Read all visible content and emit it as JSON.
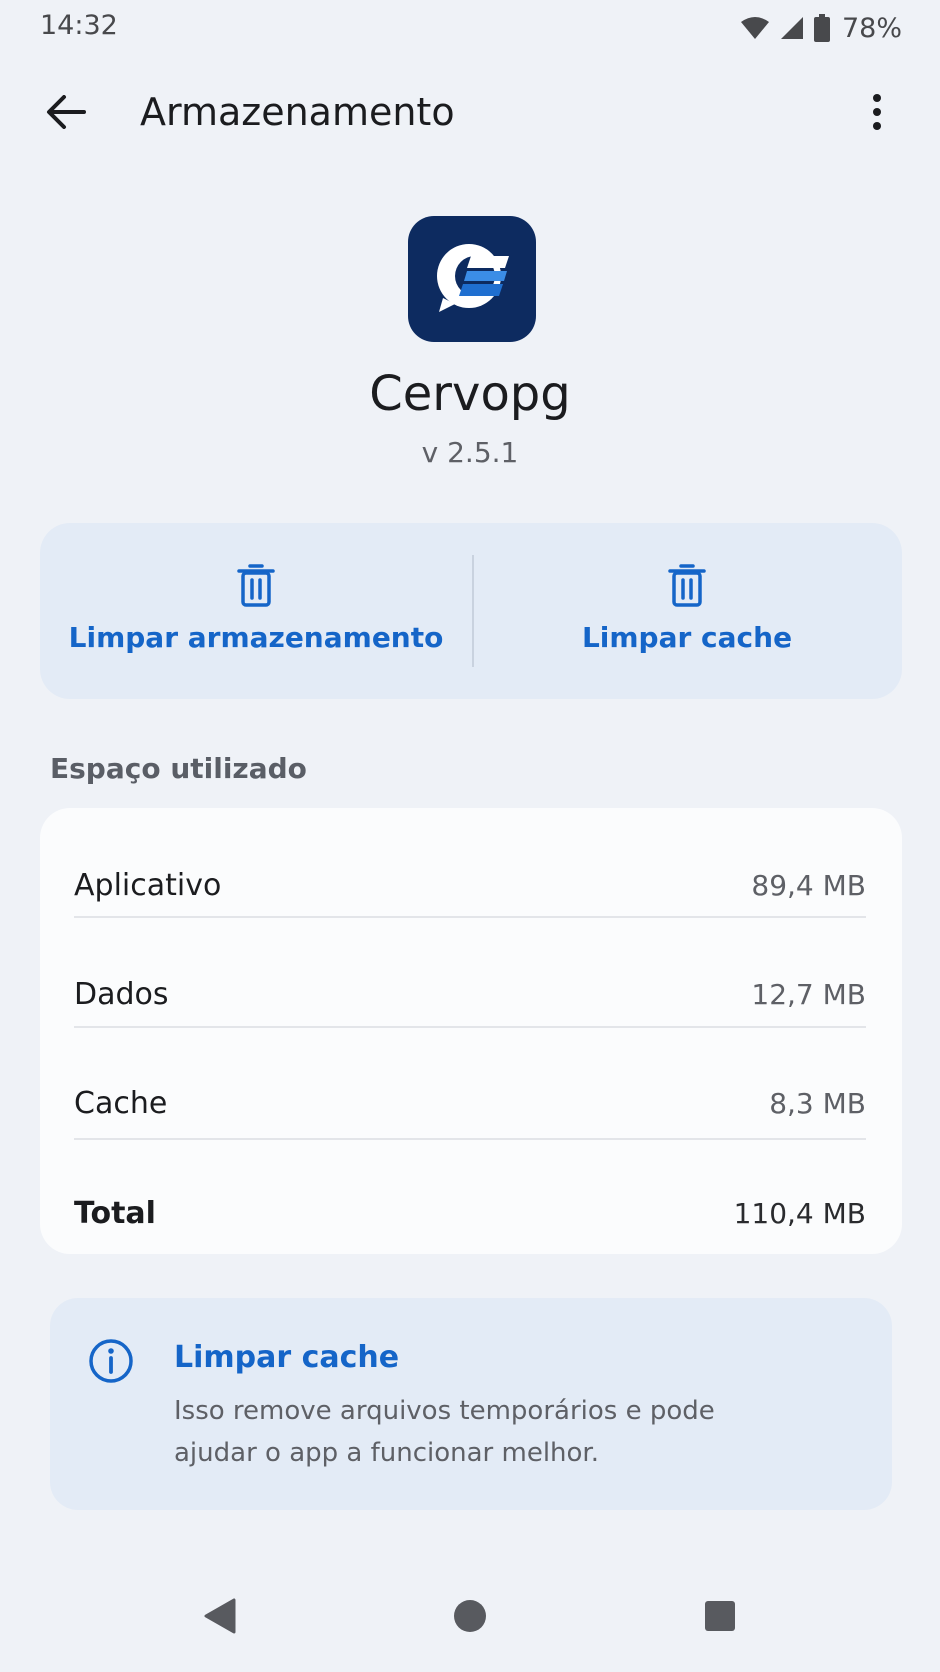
{
  "status_bar": {
    "time": "14:32",
    "battery": "78%",
    "icons": [
      "wifi-icon",
      "signal-icon",
      "battery-icon"
    ]
  },
  "app_bar": {
    "title": "Armazenamento",
    "icons": [
      "arrow-back-icon",
      "more-vert-icon"
    ]
  },
  "app": {
    "name": "Cervopg",
    "version": "v 2.5.1",
    "icon": "cervopg-logo"
  },
  "actions": {
    "clear_storage_label": "Limpar armazenamento",
    "clear_cache_label": "Limpar cache",
    "icon": "trash-icon"
  },
  "storage": {
    "section_title": "Espaço utilizado",
    "rows": [
      {
        "label": "Aplicativo",
        "value": "89,4 MB"
      },
      {
        "label": "Dados",
        "value": "12,7 MB"
      },
      {
        "label": "Cache",
        "value": "8,3 MB"
      },
      {
        "label": "Total",
        "value": "110,4 MB"
      }
    ]
  },
  "info": {
    "title": "Limpar cache",
    "description": "Isso remove arquivos temporários e pode ajudar o app a funcionar melhor.",
    "icon": "info-icon"
  },
  "nav": {
    "icons": [
      "nav-back-icon",
      "nav-home-icon",
      "nav-recents-icon"
    ]
  },
  "colors": {
    "background": "#eff2f7",
    "accent": "#1565c8",
    "card": "#fbfcfd",
    "tinted_card": "#e3ebf6",
    "app_icon_bg": "#0d2b60"
  }
}
